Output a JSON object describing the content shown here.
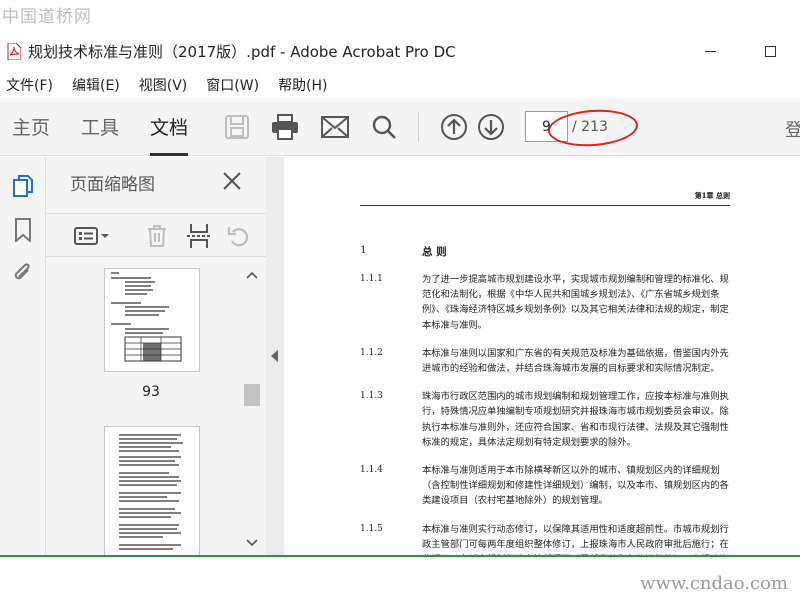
{
  "watermarks": {
    "top_left": "中国道桥网",
    "bottom_right": "www.cndao.com"
  },
  "window": {
    "title": "规划技术标准与准则（2017版）.pdf - Adobe Acrobat Pro DC"
  },
  "menu": [
    "文件(F)",
    "编辑(E)",
    "视图(V)",
    "窗口(W)",
    "帮助(H)"
  ],
  "toolbar": {
    "tabs": [
      {
        "label": "主页",
        "active": false
      },
      {
        "label": "工具",
        "active": false
      },
      {
        "label": "文档",
        "active": true
      }
    ],
    "icons": [
      "save-icon",
      "print-icon",
      "email-icon",
      "search-icon",
      "page-up-icon",
      "page-down-icon"
    ],
    "page_number": "9",
    "page_total": "/ 213",
    "cutoff_char": "登",
    "annotation_color": "#e02020"
  },
  "thumbnails_panel": {
    "title": "页面缩略图",
    "icons": [
      "options-icon",
      "delete-icon",
      "extract-icon",
      "rotate-icon"
    ],
    "pages": [
      {
        "label": "93"
      },
      {
        "label": ""
      }
    ]
  },
  "document": {
    "running_header": "第1章  总则",
    "chapter": {
      "number": "1",
      "title": "总  则"
    },
    "clauses": [
      {
        "number": "1.1.1",
        "text": "为了进一步提高城市规划建设水平，实现城市规划编制和管理的标准化、规范化和法制化，根据《中华人民共和国城乡规划法》、《广东省城乡规划条例》、《珠海经济特区城乡规划条例》以及其它相关法律和法规的规定，制定本标准与准则。"
      },
      {
        "number": "1.1.2",
        "text": "本标准与准则以国家和广东省的有关规范及标准为基础依据，借鉴国内外先进城市的经验和做法，并结合珠海城市发展的目标要求和实际情况制定。"
      },
      {
        "number": "1.1.3",
        "text": "珠海市行政区范围内的城市规划编制和规划管理工作，应按本标准与准则执行，特殊情况应单独编制专项规划研究并报珠海市城市规划委员会审议。除执行本标准与准则外，还应符合国家、省和市现行法律、法规及其它强制性标准的规定，具体法定规划有特定规划要求的除外。"
      },
      {
        "number": "1.1.4",
        "text": "本标准与准则适用于本市除横琴新区以外的城市、镇规划区内的详细规划（含控制性详细规划和修建性详细规划）编制，以及本市、镇规划区内的各类建设项目（农村宅基地除外）的规划管理。"
      },
      {
        "number": "1.1.5",
        "text": "本标准与准则实行动态修订，以保障其适用性和适度超前性。市城市规划行政主管部门可每两年度组织整体修订，上报珠海市人民政府审批后施行；在此期间，市城市规划行政主管部门可对局部章节和条款进行修订，上报珠海市人民政府备案后施行。"
      }
    ]
  },
  "colors": {
    "toolbar_bg": "#f4f4f4",
    "active_nav": "#1a73c8",
    "doc_bottom_line": "#3b8c3b"
  }
}
